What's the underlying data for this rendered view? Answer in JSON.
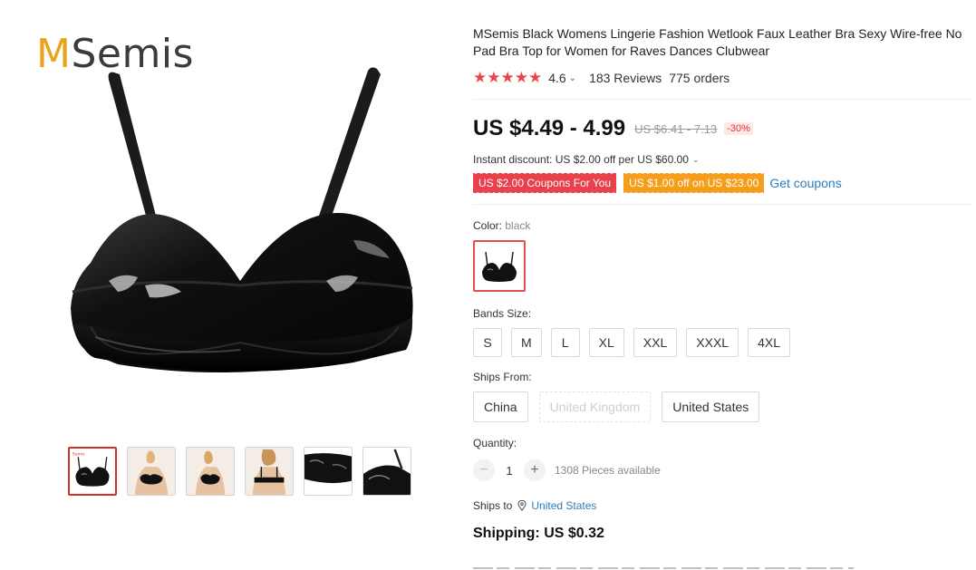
{
  "brand": {
    "logo_first": "M",
    "logo_rest": "Semis"
  },
  "thumbnails": [
    {
      "icon": "bra-front-image",
      "selected": true,
      "label": "Semis"
    },
    {
      "icon": "model-front-image"
    },
    {
      "icon": "model-angle-image"
    },
    {
      "icon": "model-back-image"
    },
    {
      "icon": "detail-closeup-image"
    },
    {
      "icon": "strap-closeup-image"
    }
  ],
  "product": {
    "title": "MSemis Black Womens Lingerie Fashion Wetlook Faux Leather Bra Sexy Wire-free No Pad Bra Top for Women for Raves Dances Clubwear",
    "stars": "★★★★★",
    "rating": "4.6",
    "reviews": "183 Reviews",
    "orders": "775 orders",
    "price": "US $4.49 - 4.99",
    "old_price": "US $6.41 - 7.13",
    "discount": "-30%",
    "instant_discount": "Instant discount: US $2.00 off per US $60.00",
    "coupons": [
      "US $2.00 Coupons For You",
      "US $1.00 off on US $23.00"
    ],
    "get_coupons": "Get coupons",
    "color_label": "Color:",
    "color_value": "black",
    "bands_label": "Bands Size:",
    "sizes": [
      "S",
      "M",
      "L",
      "XL",
      "XXL",
      "XXXL",
      "4XL"
    ],
    "ships_from_label": "Ships From:",
    "ships_from": [
      "China",
      "United Kingdom",
      "United States"
    ],
    "quantity_label": "Quantity:",
    "quantity": "1",
    "quantity_minus": "−",
    "quantity_plus": "+",
    "available": "1308 Pieces available",
    "ships_to_label": "Ships to",
    "ships_to_value": "United States",
    "shipping": "Shipping: US $0.32"
  },
  "colors": {
    "accent": "#e8414b",
    "orange": "#f79d1c",
    "link": "#2c7fbf",
    "star": "#e8464b"
  }
}
